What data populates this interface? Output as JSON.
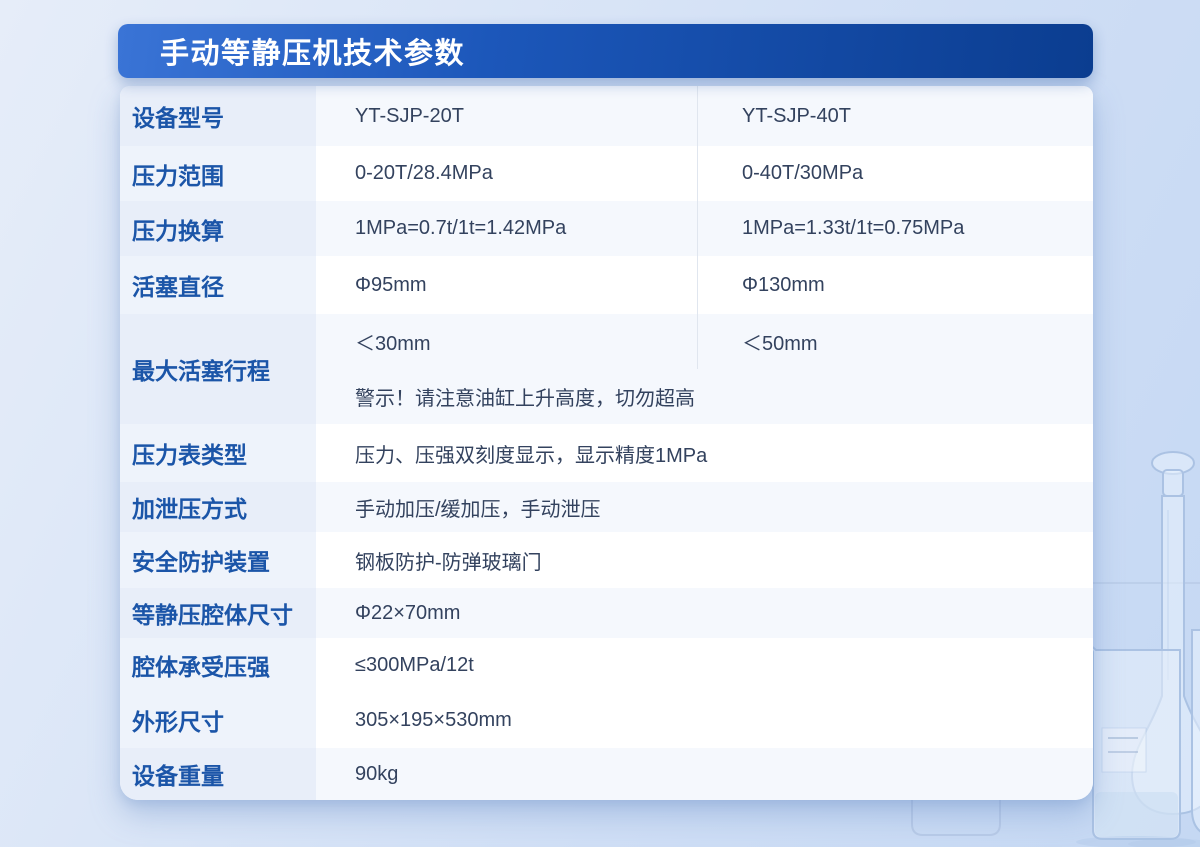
{
  "page": {
    "title": "手动等静压机技术参数"
  },
  "colors": {
    "header_gradient_start": "#3a74d6",
    "header_gradient_end": "#0b3d90",
    "header_text": "#ffffff",
    "label_text": "#1b55a8",
    "value_text": "#33425e",
    "tinted_row_bg": "#f5f8fd",
    "label_cell_bg": "#e8eef9",
    "page_bg": "#cfdef5"
  },
  "table": {
    "rows": [
      {
        "label": "设备型号",
        "values": [
          "YT-SJP-20T",
          "YT-SJP-40T"
        ]
      },
      {
        "label": "压力范围",
        "values": [
          "0-20T/28.4MPa",
          "0-40T/30MPa"
        ]
      },
      {
        "label": "压力换算",
        "values": [
          "1MPa=0.7t/1t=1.42MPa",
          "1MPa=1.33t/1t=0.75MPa"
        ]
      },
      {
        "label": "活塞直径",
        "values": [
          "Φ95mm",
          "Φ130mm"
        ]
      },
      {
        "label": "最大活塞行程",
        "values": [
          "＜30mm",
          "＜50mm"
        ],
        "note": "警示！请注意油缸上升高度，切勿超高"
      },
      {
        "label": "压力表类型",
        "values": [
          "压力、压强双刻度显示，显示精度1MPa"
        ]
      },
      {
        "label": "加泄压方式",
        "values": [
          "手动加压/缓加压，手动泄压"
        ]
      },
      {
        "label": "安全防护装置",
        "values": [
          "钢板防护-防弹玻璃门"
        ]
      },
      {
        "label": "等静压腔体尺寸",
        "values": [
          "Φ22×70mm"
        ]
      },
      {
        "label": "腔体承受压强",
        "values": [
          "≤300MPa/12t"
        ]
      },
      {
        "label": "外形尺寸",
        "values": [
          "305×195×530mm"
        ]
      },
      {
        "label": "设备重量",
        "values": [
          "90kg"
        ]
      }
    ]
  },
  "decor": {
    "items": [
      "volumetric-flask",
      "beaker",
      "small-beaker",
      "shelf-line"
    ]
  }
}
